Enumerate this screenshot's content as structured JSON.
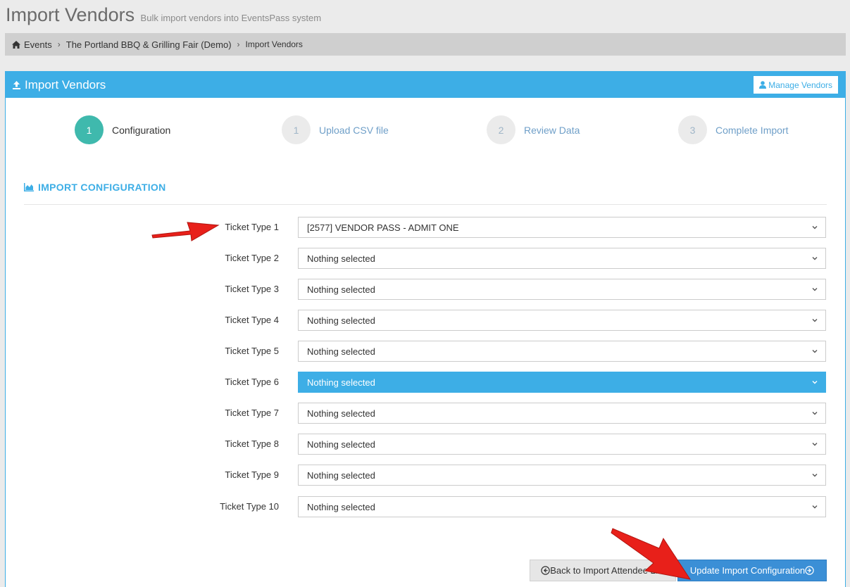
{
  "page": {
    "title": "Import Vendors",
    "subtitle": "Bulk import vendors into EventsPass system"
  },
  "breadcrumb": {
    "items": [
      "Events",
      "The Portland BBQ & Grilling Fair (Demo)",
      "Import Vendors"
    ]
  },
  "panel": {
    "title": "Import Vendors",
    "manage_button": "Manage Vendors"
  },
  "wizard": {
    "steps": [
      {
        "number": "1",
        "label": "Configuration",
        "active": true
      },
      {
        "number": "1",
        "label": "Upload CSV file",
        "active": false
      },
      {
        "number": "2",
        "label": "Review Data",
        "active": false
      },
      {
        "number": "3",
        "label": "Complete Import",
        "active": false
      }
    ]
  },
  "section": {
    "title": "IMPORT CONFIGURATION"
  },
  "ticket_types": [
    {
      "label": "Ticket Type 1",
      "value": "[2577] VENDOR PASS - ADMIT ONE"
    },
    {
      "label": "Ticket Type 2",
      "value": "Nothing selected"
    },
    {
      "label": "Ticket Type 3",
      "value": "Nothing selected"
    },
    {
      "label": "Ticket Type 4",
      "value": "Nothing selected"
    },
    {
      "label": "Ticket Type 5",
      "value": "Nothing selected"
    },
    {
      "label": "Ticket Type 6",
      "value": "Nothing selected",
      "highlighted": true
    },
    {
      "label": "Ticket Type 7",
      "value": "Nothing selected"
    },
    {
      "label": "Ticket Type 8",
      "value": "Nothing selected"
    },
    {
      "label": "Ticket Type 9",
      "value": "Nothing selected"
    },
    {
      "label": "Ticket Type 10",
      "value": "Nothing selected"
    }
  ],
  "buttons": {
    "back": "Back to Import Attendee List",
    "update": "Update Import Configuration"
  },
  "colors": {
    "accent": "#3daee6",
    "active_step": "#3fb9ad",
    "primary_button": "#3b8fd6",
    "annotation_arrow": "#e8201a"
  }
}
